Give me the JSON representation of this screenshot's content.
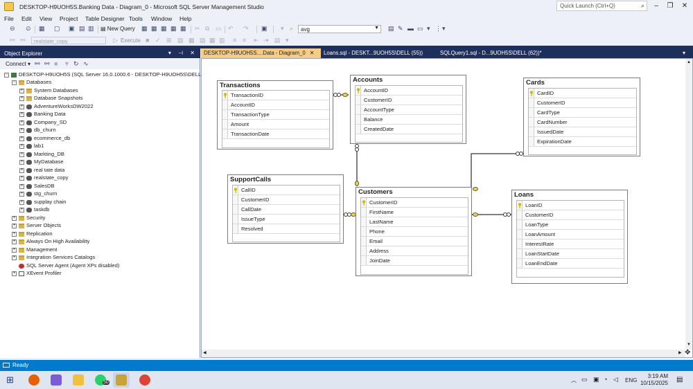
{
  "window": {
    "title": "DESKTOP-H9UOH5S.Banking Data - Diagram_0 - Microsoft SQL Server Management Studio",
    "quick_launch_placeholder": "Quick Launch (Ctrl+Q)"
  },
  "menu": [
    "File",
    "Edit",
    "View",
    "Project",
    "Table Designer",
    "Tools",
    "Window",
    "Help"
  ],
  "toolbar": {
    "new_query": "New Query",
    "search_combo": "avg",
    "database_combo": "realstate_copy",
    "execute": "Execute"
  },
  "object_explorer": {
    "title": "Object Explorer",
    "connect": "Connect",
    "server": "DESKTOP-H9UOH5S (SQL Server 16.0.1000.6 - DESKTOP-H9UOH5S\\DELL)",
    "databases_label": "Databases",
    "databases": [
      "System Databases",
      "Database Snapshots",
      "AdventureWorksDW2022",
      "Banking Data",
      "Company_SD",
      "db_churn",
      "ecommerce_db",
      "lab1",
      "Markting_DB",
      "MyDatabase",
      "real tate data",
      "realstate_copy",
      "SalesDB",
      "stg_churn",
      "supplay chain",
      "taskdb"
    ],
    "server_nodes": [
      "Security",
      "Server Objects",
      "Replication",
      "Always On High Availability",
      "Management",
      "Integration Services Catalogs",
      "SQL Server Agent (Agent XPs disabled)",
      "XEvent Profiler"
    ]
  },
  "tabs": [
    {
      "label": "DESKTOP-H9UOH5S....Data - Diagram_0",
      "close": "✕"
    },
    {
      "label": "Loans.sql - DESKT...9UOH5S\\DELL (55))"
    },
    {
      "label": "SQLQuery1.sql - D...9UOH5S\\DELL (62))*"
    }
  ],
  "diagram": {
    "tables": {
      "transactions": {
        "name": "Transactions",
        "columns": [
          "TransactionID",
          "AccountID",
          "TransactionType",
          "Amount",
          "TransactionDate"
        ]
      },
      "accounts": {
        "name": "Accounts",
        "columns": [
          "AccountID",
          "CustomerID",
          "AccountType",
          "Balance",
          "CreatedDate"
        ]
      },
      "cards": {
        "name": "Cards",
        "columns": [
          "CardID",
          "CustomerID",
          "CardType",
          "CardNumber",
          "IssuedDate",
          "ExpirationDate"
        ]
      },
      "supportcalls": {
        "name": "SupportCalls",
        "columns": [
          "CallID",
          "CustomerID",
          "CallDate",
          "IssueType",
          "Resolved"
        ]
      },
      "customers": {
        "name": "Customers",
        "columns": [
          "CustomerID",
          "FirstName",
          "LastName",
          "Phone",
          "Email",
          "Address",
          "JoinDate"
        ]
      },
      "loans": {
        "name": "Loans",
        "columns": [
          "LoanID",
          "CustomerID",
          "LoanType",
          "LoanAmount",
          "InterestRate",
          "LoanStartDate",
          "LoanEndDate"
        ]
      }
    }
  },
  "status": {
    "text": "Ready"
  },
  "taskbar": {
    "language": "ENG",
    "time": "3:19 AM",
    "date": "10/15/2025",
    "whatsapp_badge": "50"
  },
  "colors": {
    "accent": "#007acc",
    "band": "#1f2f5c",
    "active_tab": "#f5cc84",
    "key": "#d6b800"
  }
}
